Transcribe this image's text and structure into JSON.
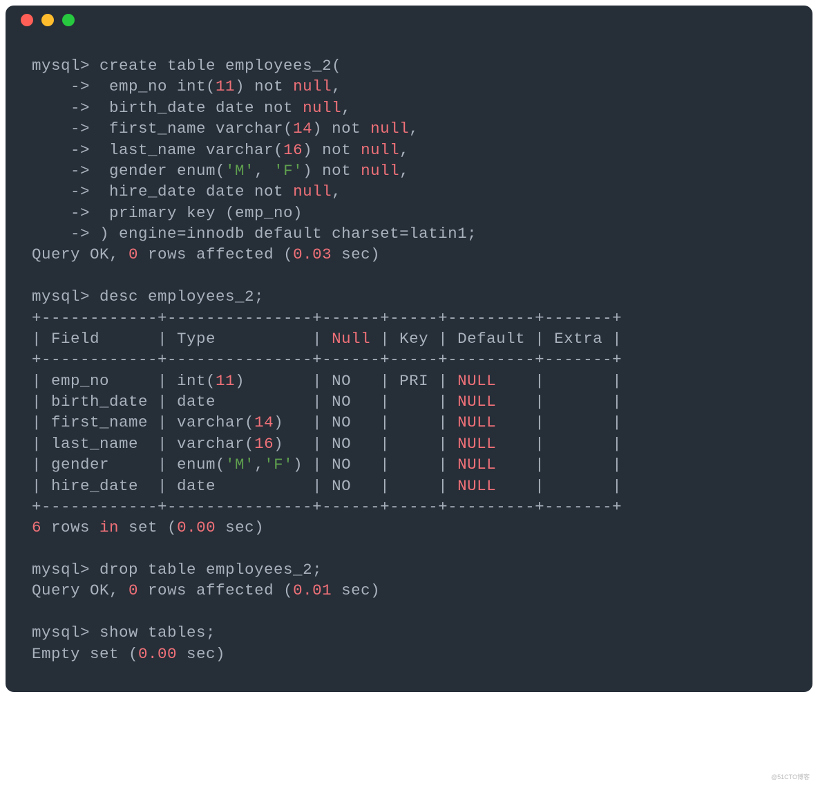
{
  "watermark": "@51CTO博客",
  "prompt": "mysql>",
  "cont": "    ->",
  "colors": {
    "keyword": "#f07178",
    "background": "#262e38",
    "text": "#a8b2bd"
  },
  "create": {
    "l1": " create table employees_2(",
    "l2_a": "  emp_no int(",
    "l2_b": "11",
    "l2_c": ") not ",
    "l2_d": "null",
    "l2_e": ",",
    "l3_a": "  birth_date date not ",
    "l3_b": "null",
    "l3_c": ",",
    "l4_a": "  first_name varchar(",
    "l4_b": "14",
    "l4_c": ") not ",
    "l4_d": "null",
    "l4_e": ",",
    "l5_a": "  last_name varchar(",
    "l5_b": "16",
    "l5_c": ") not ",
    "l5_d": "null",
    "l5_e": ",",
    "l6_a": "  gender enum(",
    "l6_b": "'M'",
    "l6_c": ", ",
    "l6_d": "'F'",
    "l6_e": ") not ",
    "l6_f": "null",
    "l6_g": ",",
    "l7_a": "  hire_date date not ",
    "l7_b": "null",
    "l7_c": ",",
    "l8": "  primary key (emp_no)",
    "l9": " ) engine=innodb default charset=latin1;"
  },
  "result1_a": "Query OK, ",
  "result1_b": "0",
  "result1_c": " rows affected (",
  "result1_d": "0.03",
  "result1_e": " sec)",
  "desc_cmd": " desc employees_2;",
  "table": {
    "border": "+------------+---------------+------+-----+---------+-------+",
    "header_a": "| Field      | Type          | ",
    "header_b": "Null",
    "header_c": " | Key | Default | Extra |",
    "rows": [
      {
        "a": "| emp_no     | int(",
        "b": "11",
        "c": ")       | NO   | PRI | ",
        "d": "NULL",
        "e": "    |       |"
      },
      {
        "a": "| birth_date | date          | NO   |     | ",
        "b": "",
        "c": "",
        "d": "NULL",
        "e": "    |       |"
      },
      {
        "a": "| first_name | varchar(",
        "b": "14",
        "c": ")   | NO   |     | ",
        "d": "NULL",
        "e": "    |       |"
      },
      {
        "a": "| last_name  | varchar(",
        "b": "16",
        "c": ")   | NO   |     | ",
        "d": "NULL",
        "e": "    |       |"
      },
      {
        "a": "| gender     | enum(",
        "b": "'M'",
        "c": ",",
        "b2": "'F'",
        "c2": ") | NO   |     | ",
        "d": "NULL",
        "e": "    |       |"
      },
      {
        "a": "| hire_date  | date          | NO   |     | ",
        "b": "",
        "c": "",
        "d": "NULL",
        "e": "    |       |"
      }
    ]
  },
  "rows_in_set_a": "6",
  "rows_in_set_b": " rows ",
  "rows_in_set_c": "in",
  "rows_in_set_d": " set (",
  "rows_in_set_e": "0.00",
  "rows_in_set_f": " sec)",
  "drop_cmd": " drop table employees_2;",
  "result2_a": "Query OK, ",
  "result2_b": "0",
  "result2_c": " rows affected (",
  "result2_d": "0.01",
  "result2_e": " sec)",
  "show_cmd": " show tables;",
  "empty_a": "Empty set (",
  "empty_b": "0.00",
  "empty_c": " sec)"
}
